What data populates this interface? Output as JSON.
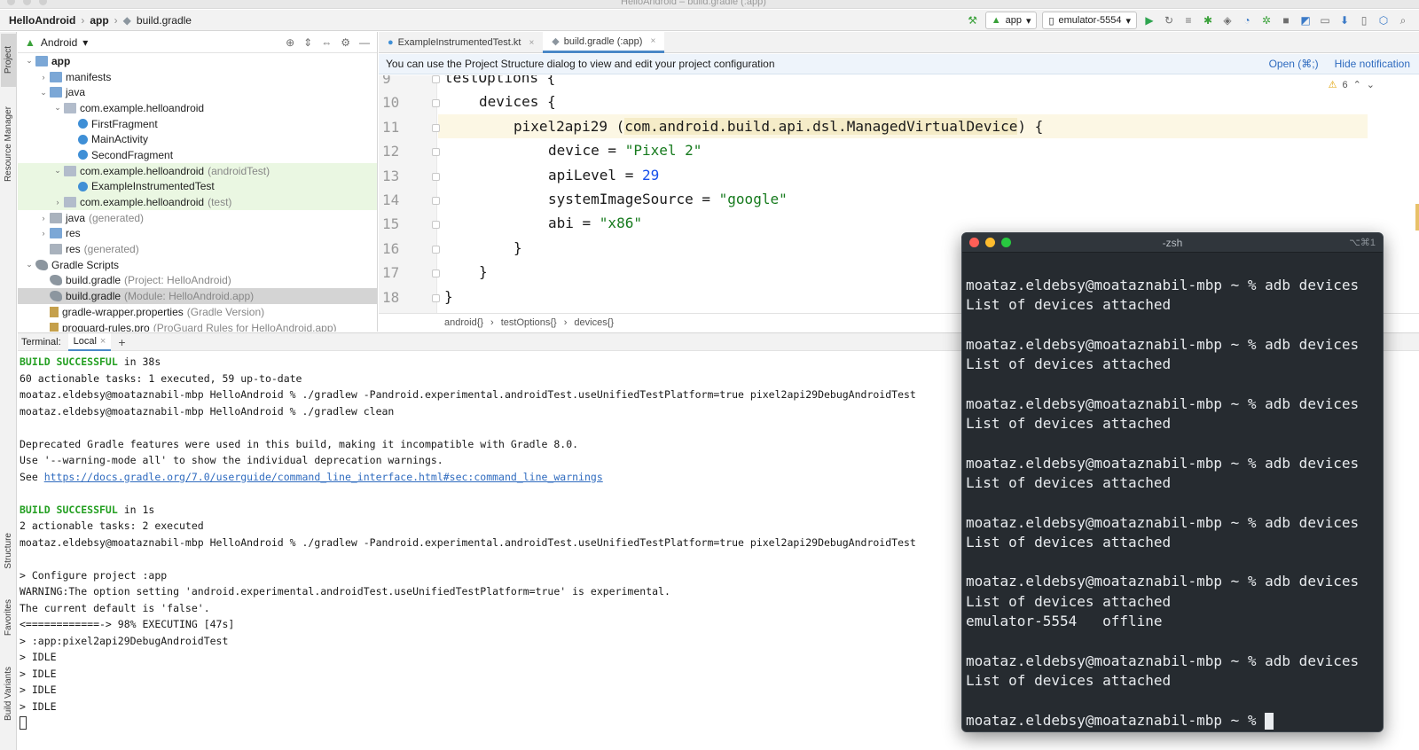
{
  "window": {
    "title": "HelloAndroid – build.gradle (:app)"
  },
  "breadcrumb": {
    "project": "HelloAndroid",
    "module": "app",
    "file": "build.gradle"
  },
  "toolbar": {
    "config": "app",
    "device": "emulator-5554"
  },
  "side_tabs": {
    "project": "Project",
    "resource_manager": "Resource Manager",
    "structure": "Structure",
    "favorites": "Favorites",
    "build_variants": "Build Variants"
  },
  "project_panel": {
    "view": "Android",
    "tree": [
      {
        "label": "app",
        "bold": true,
        "level": 0,
        "arrow": "open",
        "icon": "folder"
      },
      {
        "label": "manifests",
        "level": 1,
        "arrow": "closed",
        "icon": "folder"
      },
      {
        "label": "java",
        "level": 1,
        "arrow": "open",
        "icon": "folder"
      },
      {
        "label": "com.example.helloandroid",
        "level": 2,
        "arrow": "open",
        "icon": "package"
      },
      {
        "label": "FirstFragment",
        "level": 3,
        "arrow": "none",
        "icon": "kotlin"
      },
      {
        "label": "MainActivity",
        "level": 3,
        "arrow": "none",
        "icon": "kotlin"
      },
      {
        "label": "SecondFragment",
        "level": 3,
        "arrow": "none",
        "icon": "kotlin"
      },
      {
        "label": "com.example.helloandroid",
        "suffix": "(androidTest)",
        "level": 2,
        "arrow": "open",
        "icon": "package",
        "test": true
      },
      {
        "label": "ExampleInstrumentedTest",
        "level": 3,
        "arrow": "none",
        "icon": "kotlin",
        "test": true
      },
      {
        "label": "com.example.helloandroid",
        "suffix": "(test)",
        "level": 2,
        "arrow": "closed",
        "icon": "package",
        "test": true
      },
      {
        "label": "java",
        "suffix": "(generated)",
        "level": 1,
        "arrow": "closed",
        "icon": "folder-gray"
      },
      {
        "label": "res",
        "level": 1,
        "arrow": "closed",
        "icon": "folder"
      },
      {
        "label": "res",
        "suffix": "(generated)",
        "level": 1,
        "arrow": "none",
        "icon": "folder-gray"
      },
      {
        "label": "Gradle Scripts",
        "level": 0,
        "arrow": "open",
        "icon": "gradle"
      },
      {
        "label": "build.gradle",
        "suffix": "(Project: HelloAndroid)",
        "level": 1,
        "arrow": "none",
        "icon": "gradle"
      },
      {
        "label": "build.gradle",
        "suffix": "(Module: HelloAndroid.app)",
        "level": 1,
        "arrow": "none",
        "icon": "gradle",
        "selected": true
      },
      {
        "label": "gradle-wrapper.properties",
        "suffix": "(Gradle Version)",
        "level": 1,
        "arrow": "none",
        "icon": "properties"
      },
      {
        "label": "proguard-rules.pro",
        "suffix": "(ProGuard Rules for HelloAndroid.app)",
        "level": 1,
        "arrow": "none",
        "icon": "properties"
      }
    ]
  },
  "editor": {
    "tabs": [
      {
        "label": "ExampleInstrumentedTest.kt",
        "active": false
      },
      {
        "label": "build.gradle (:app)",
        "active": true
      }
    ],
    "notification": {
      "text": "You can use the Project Structure dialog to view and edit your project configuration",
      "open": "Open (⌘;)",
      "hide": "Hide notification"
    },
    "warning_count": "6",
    "lines": [
      {
        "no": "9",
        "indent": 1,
        "parts": [
          {
            "t": "testOptions {",
            "c": ""
          }
        ]
      },
      {
        "no": "10",
        "indent": 2,
        "parts": [
          {
            "t": "devices {",
            "c": ""
          }
        ]
      },
      {
        "no": "11",
        "indent": 3,
        "parts": [
          {
            "t": "pixel2api29 (",
            "c": ""
          },
          {
            "t": "com.android.build.api.dsl.ManagedVirtualDevice",
            "c": "hl"
          },
          {
            "t": ") {",
            "c": ""
          }
        ]
      },
      {
        "no": "12",
        "indent": 4,
        "parts": [
          {
            "t": "device = ",
            "c": ""
          },
          {
            "t": "\"Pixel 2\"",
            "c": "str"
          }
        ]
      },
      {
        "no": "13",
        "indent": 4,
        "parts": [
          {
            "t": "apiLevel = ",
            "c": ""
          },
          {
            "t": "29",
            "c": "num"
          }
        ]
      },
      {
        "no": "14",
        "indent": 4,
        "parts": [
          {
            "t": "systemImageSource = ",
            "c": ""
          },
          {
            "t": "\"google\"",
            "c": "str"
          }
        ]
      },
      {
        "no": "15",
        "indent": 4,
        "parts": [
          {
            "t": "abi = ",
            "c": ""
          },
          {
            "t": "\"x86\"",
            "c": "str"
          }
        ]
      },
      {
        "no": "16",
        "indent": 3,
        "parts": [
          {
            "t": "}",
            "c": ""
          }
        ]
      },
      {
        "no": "17",
        "indent": 2,
        "parts": [
          {
            "t": "}",
            "c": ""
          }
        ]
      },
      {
        "no": "18",
        "indent": 1,
        "parts": [
          {
            "t": "}",
            "c": ""
          }
        ]
      }
    ],
    "crumbs": [
      "android{}",
      "testOptions{}",
      "devices{}"
    ]
  },
  "terminal": {
    "label": "Terminal:",
    "tab": "Local",
    "add": "+",
    "lines": [
      {
        "parts": [
          {
            "t": "BUILD SUCCESSFUL",
            "c": "ok"
          },
          {
            "t": " in 38s",
            "c": ""
          }
        ]
      },
      {
        "parts": [
          {
            "t": "60 actionable tasks: 1 executed, 59 up-to-date",
            "c": ""
          }
        ]
      },
      {
        "parts": [
          {
            "t": "moataz.eldebsy@moataznabil-mbp HelloAndroid % ./gradlew -Pandroid.experimental.androidTest.useUnifiedTestPlatform=true pixel2api29DebugAndroidTest",
            "c": ""
          }
        ]
      },
      {
        "parts": [
          {
            "t": "moataz.eldebsy@moataznabil-mbp HelloAndroid % ./gradlew clean",
            "c": ""
          }
        ]
      },
      {
        "parts": [
          {
            "t": "",
            "c": ""
          }
        ]
      },
      {
        "parts": [
          {
            "t": "Deprecated Gradle features were used in this build, making it incompatible with Gradle 8.0.",
            "c": ""
          }
        ]
      },
      {
        "parts": [
          {
            "t": "Use '--warning-mode all' to show the individual deprecation warnings.",
            "c": ""
          }
        ]
      },
      {
        "parts": [
          {
            "t": "See ",
            "c": ""
          },
          {
            "t": "https://docs.gradle.org/7.0/userguide/command_line_interface.html#sec:command_line_warnings",
            "c": "lnk"
          }
        ]
      },
      {
        "parts": [
          {
            "t": "",
            "c": ""
          }
        ]
      },
      {
        "parts": [
          {
            "t": "BUILD SUCCESSFUL",
            "c": "ok"
          },
          {
            "t": " in 1s",
            "c": ""
          }
        ]
      },
      {
        "parts": [
          {
            "t": "2 actionable tasks: 2 executed",
            "c": ""
          }
        ]
      },
      {
        "parts": [
          {
            "t": "moataz.eldebsy@moataznabil-mbp HelloAndroid % ./gradlew -Pandroid.experimental.androidTest.useUnifiedTestPlatform=true pixel2api29DebugAndroidTest",
            "c": ""
          }
        ]
      },
      {
        "parts": [
          {
            "t": "",
            "c": ""
          }
        ]
      },
      {
        "parts": [
          {
            "t": "> Configure project :app",
            "c": ""
          }
        ]
      },
      {
        "parts": [
          {
            "t": "WARNING:The option setting 'android.experimental.androidTest.useUnifiedTestPlatform=true' is experimental.",
            "c": ""
          }
        ]
      },
      {
        "parts": [
          {
            "t": "The current default is 'false'.",
            "c": ""
          }
        ]
      },
      {
        "parts": [
          {
            "t": "<============-> 98% EXECUTING [47s]",
            "c": ""
          }
        ]
      },
      {
        "parts": [
          {
            "t": "> :app:pixel2api29DebugAndroidTest",
            "c": ""
          }
        ]
      },
      {
        "parts": [
          {
            "t": "> IDLE",
            "c": ""
          }
        ]
      },
      {
        "parts": [
          {
            "t": "> IDLE",
            "c": ""
          }
        ]
      },
      {
        "parts": [
          {
            "t": "> IDLE",
            "c": ""
          }
        ]
      },
      {
        "parts": [
          {
            "t": "> IDLE",
            "c": ""
          }
        ]
      }
    ]
  },
  "mac_terminal": {
    "title": "-zsh",
    "shortcut": "⌥⌘1",
    "lines": [
      "moataz.eldebsy@moataznabil-mbp ~ % adb devices",
      "List of devices attached",
      "",
      "moataz.eldebsy@moataznabil-mbp ~ % adb devices",
      "List of devices attached",
      "",
      "moataz.eldebsy@moataznabil-mbp ~ % adb devices",
      "List of devices attached",
      "",
      "moataz.eldebsy@moataznabil-mbp ~ % adb devices",
      "List of devices attached",
      "",
      "moataz.eldebsy@moataznabil-mbp ~ % adb devices",
      "List of devices attached",
      "",
      "moataz.eldebsy@moataznabil-mbp ~ % adb devices",
      "List of devices attached",
      "emulator-5554   offline",
      "",
      "moataz.eldebsy@moataznabil-mbp ~ % adb devices",
      "List of devices attached",
      "",
      "moataz.eldebsy@moataznabil-mbp ~ % "
    ]
  },
  "colors": {
    "accent": "#4a88c7",
    "success": "#25a023",
    "link": "#2f6bbf",
    "close": "#ff5f57",
    "minimize": "#febc2e",
    "zoom": "#28c840"
  }
}
